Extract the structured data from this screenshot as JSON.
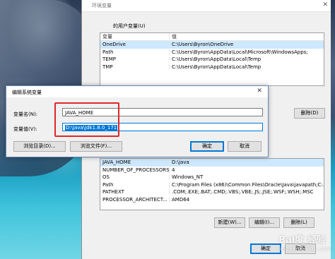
{
  "env_window": {
    "title": "环境变量",
    "close_glyph": "✕",
    "user_section_label": "的用户变量(U)",
    "list_headers": [
      "变量",
      "值"
    ],
    "user_vars": [
      {
        "name": "OneDrive",
        "value": "C:\\Users\\Byron\\OneDrive"
      },
      {
        "name": "Path",
        "value": "C:\\Users\\Byron\\AppData\\Local\\Microsoft\\WindowsApps;"
      },
      {
        "name": "TEMP",
        "value": "C:\\Users\\Byron\\AppData\\Local\\Temp"
      },
      {
        "name": "TMP",
        "value": "C:\\Users\\Byron\\AppData\\Local\\Temp"
      }
    ],
    "user_delete_button": "删除(D)",
    "system_vars": [
      {
        "name": "JAVA_HOME",
        "value": "D:\\java"
      },
      {
        "name": "NUMBER_OF_PROCESSORS",
        "value": "4"
      },
      {
        "name": "OS",
        "value": "Windows_NT"
      },
      {
        "name": "Path",
        "value": "C:\\Program Files (x86)\\Common Files\\Oracle\\Java\\javapath;C:..."
      },
      {
        "name": "PATHEXT",
        "value": ".COM;.EXE;.BAT;.CMD;.VBS;.VBE;.JS;.JSE;.WSF;.WSH;.MSC"
      },
      {
        "name": "PROCESSOR_ARCHITECT...",
        "value": "AMD64"
      }
    ],
    "system_buttons": {
      "new": "新建(W)...",
      "edit": "编辑(I)...",
      "delete": "删除(L)"
    },
    "footer_buttons": {
      "ok": "确定",
      "cancel": "取消"
    }
  },
  "edit_dialog": {
    "title": "编辑系统变量",
    "close_glyph": "✕",
    "name_label": "变量名(N):",
    "name_value": "JAVA_HOME",
    "value_label": "变量值(V):",
    "value_value": "D:\\java\\jdk1.8.0_171",
    "browse_dir": "浏览目录(D)...",
    "browse_file": "浏览文件(F)...",
    "ok": "确定",
    "cancel": "取消"
  },
  "watermark": {
    "text": "Bai度 经验",
    "sub": "jingyan.baidu.com"
  }
}
